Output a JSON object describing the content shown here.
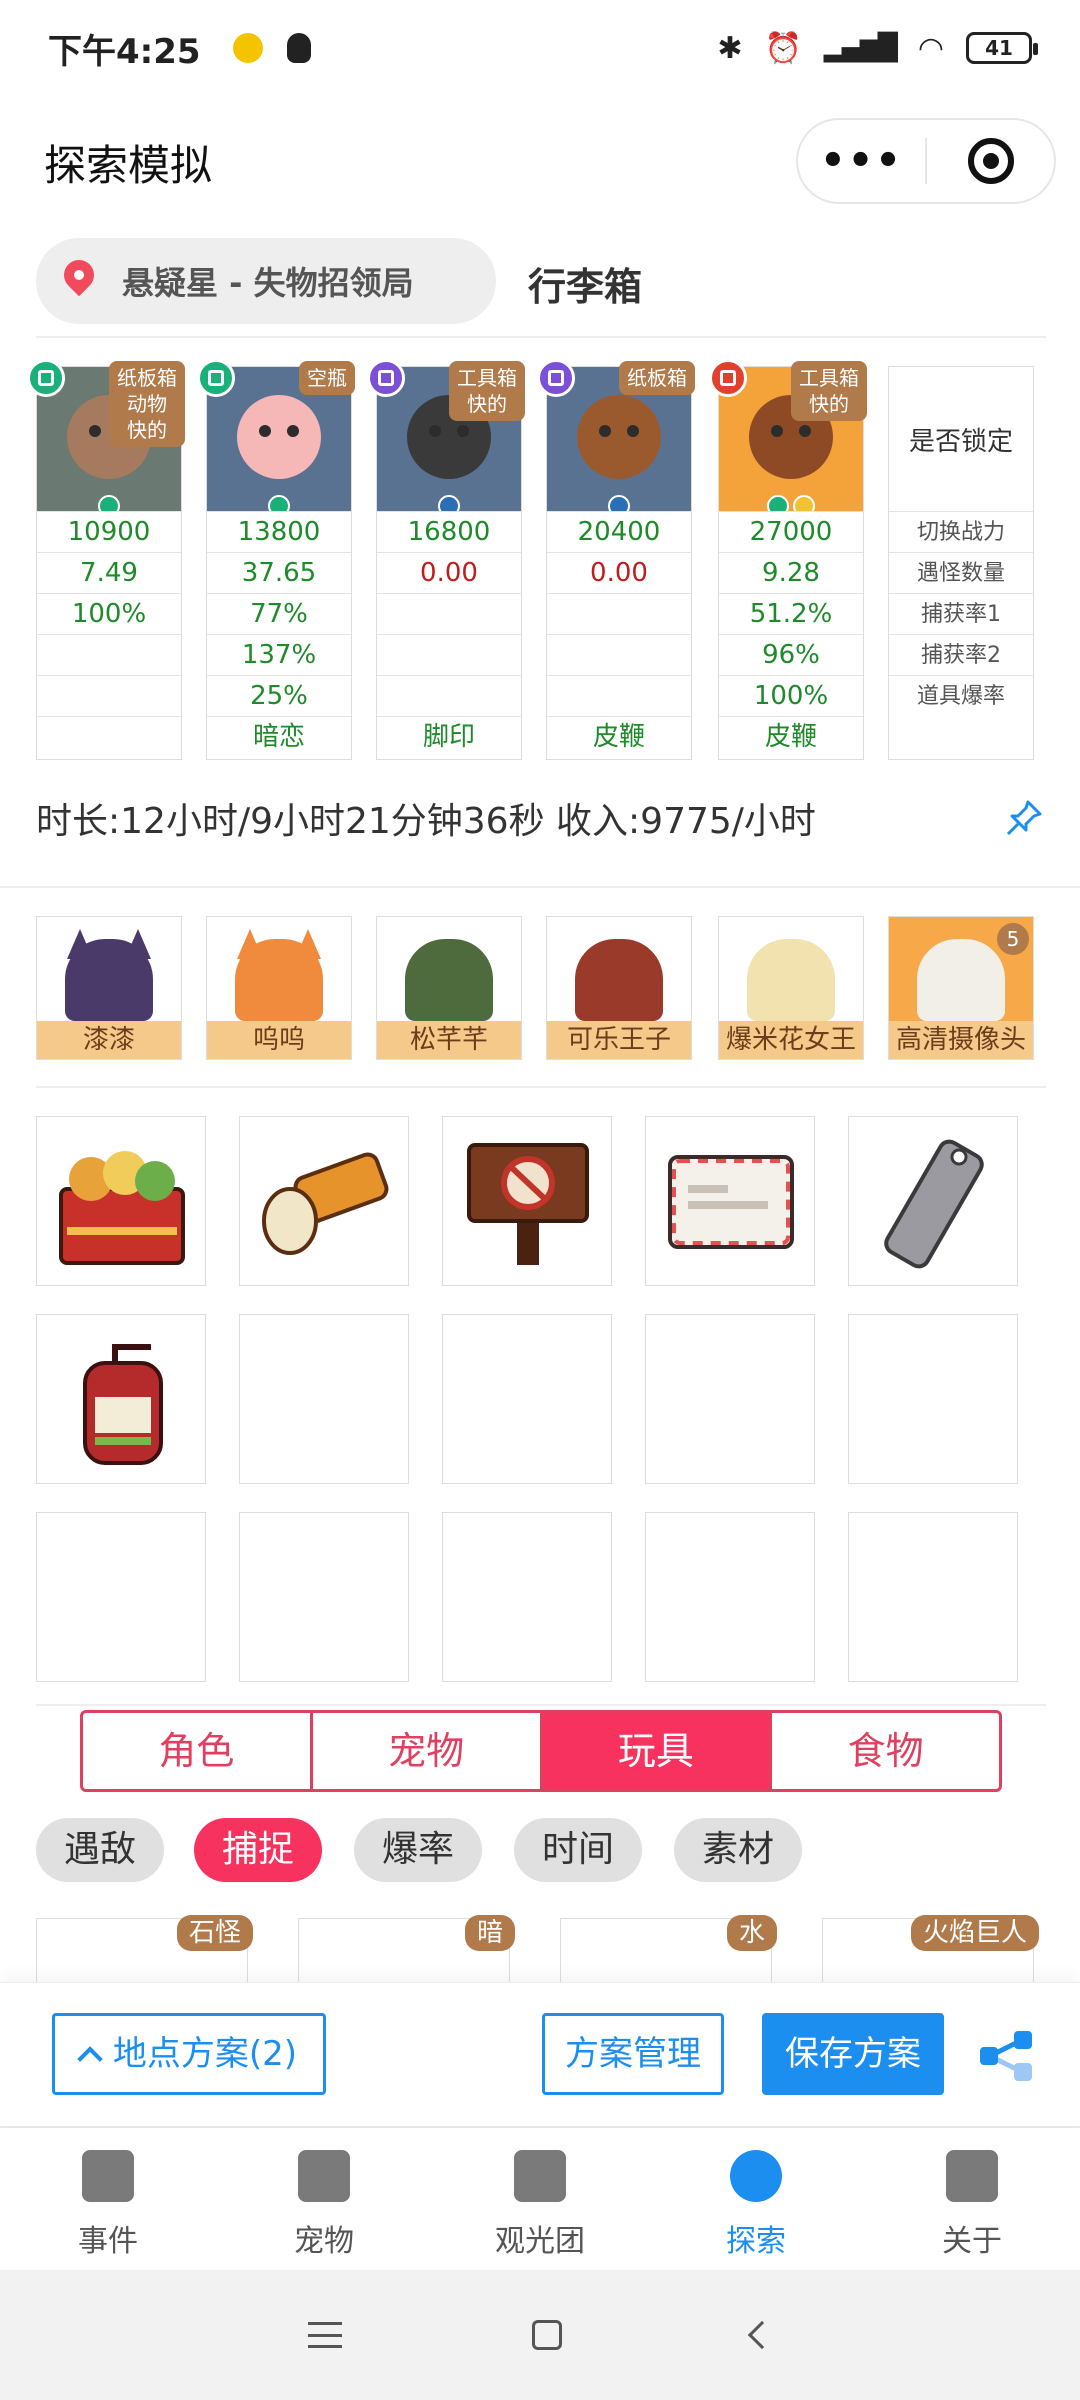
{
  "status_bar": {
    "time": "下午4:25",
    "battery": "41"
  },
  "header": {
    "title": "探索模拟",
    "more_label": "•••"
  },
  "location": {
    "name": "悬疑星 - 失物招领局",
    "bag_title": "行李箱"
  },
  "team": {
    "columns": [
      {
        "tag": "纸板箱\n动物\n快的",
        "badge_color": "#19b07a",
        "bg": "#6a7a72",
        "body": "#a57a5e",
        "values": [
          "10900",
          "7.49",
          "100%",
          "",
          "",
          ""
        ],
        "colors": [
          "green",
          "green",
          "green",
          "green",
          "green",
          "green"
        ]
      },
      {
        "tag": "空瓶",
        "badge_color": "#19b07a",
        "bg": "#5a7291",
        "body": "#f6b7b7",
        "values": [
          "13800",
          "37.65",
          "77%",
          "137%",
          "25%",
          "暗恋"
        ],
        "colors": [
          "green",
          "green",
          "green",
          "green",
          "green",
          "green"
        ]
      },
      {
        "tag": "工具箱\n快的",
        "badge_color": "#7b4fd6",
        "bg": "#5a7291",
        "body": "#3a3a3a",
        "values": [
          "16800",
          "0.00",
          "",
          "",
          "",
          "脚印"
        ],
        "colors": [
          "green",
          "red",
          "green",
          "green",
          "green",
          "green"
        ]
      },
      {
        "tag": "纸板箱",
        "badge_color": "#7b4fd6",
        "bg": "#5a7291",
        "body": "#9a5a2e",
        "values": [
          "20400",
          "0.00",
          "",
          "",
          "",
          "皮鞭"
        ],
        "colors": [
          "green",
          "red",
          "green",
          "green",
          "green",
          "green"
        ]
      },
      {
        "tag": "工具箱\n快的",
        "badge_color": "#e0402c",
        "bg": "#f3a33a",
        "body": "#8e4a25",
        "values": [
          "27000",
          "9.28",
          "51.2%",
          "96%",
          "100%",
          "皮鞭"
        ],
        "colors": [
          "green",
          "green",
          "green",
          "green",
          "green",
          "green"
        ]
      }
    ],
    "label_header": "是否锁定",
    "row_labels": [
      "切换战力",
      "遇怪数量",
      "捕获率1",
      "捕获率2",
      "道具爆率"
    ]
  },
  "summary": {
    "duration_text": "时长:12小时/9小时21分钟36秒 收入:9775/小时"
  },
  "pets": [
    {
      "name": "漆漆",
      "bg": "#ffffff",
      "face": "#4a3a6a"
    },
    {
      "name": "呜呜",
      "bg": "#ffffff",
      "face": "#f08a3c"
    },
    {
      "name": "松芊芊",
      "bg": "#ffffff",
      "face": "#4e6b3e"
    },
    {
      "name": "可乐王子",
      "bg": "#ffffff",
      "face": "#9a3a2a"
    },
    {
      "name": "爆米花女王",
      "bg": "#ffffff",
      "face": "#f1e2b0"
    },
    {
      "name": "高清摄像头",
      "bg": "#f7a94a",
      "face": "#f2eee8",
      "count": "5"
    }
  ],
  "items": [
    {
      "name": "bento-box-icon",
      "color": "#c8312a"
    },
    {
      "name": "flashlight-icon",
      "color": "#e5932a"
    },
    {
      "name": "no-sign-board-icon",
      "color": "#7a3a20"
    },
    {
      "name": "envelope-icon",
      "color": "#f4f1ea"
    },
    {
      "name": "tag-icon",
      "color": "#9a9aa0"
    },
    {
      "name": "fire-extinguisher-icon",
      "color": "#b52a2a"
    }
  ],
  "category_tabs": [
    "角色",
    "宠物",
    "玩具",
    "食物"
  ],
  "active_category": "玩具",
  "filters": [
    "遇敌",
    "捕捉",
    "爆率",
    "时间",
    "素材"
  ],
  "active_filter": "捕捉",
  "toy_tags": [
    "石怪",
    "暗",
    "水",
    "火焰巨人"
  ],
  "actions": {
    "plan_label": "地点方案(2)",
    "manage_label": "方案管理",
    "save_label": "保存方案"
  },
  "tabbar": [
    {
      "label": "事件",
      "icon": "flag-icon"
    },
    {
      "label": "宠物",
      "icon": "pet-icon"
    },
    {
      "label": "观光团",
      "icon": "tour-icon"
    },
    {
      "label": "探索",
      "icon": "explore-icon"
    },
    {
      "label": "关于",
      "icon": "about-icon"
    }
  ],
  "active_tab": "探索",
  "colors": {
    "accent": "#f7325e",
    "primary": "#1c8ef0",
    "stat_green": "#1e8a2a",
    "stat_red": "#c21b1b",
    "tag_brown": "#b07a4a"
  }
}
